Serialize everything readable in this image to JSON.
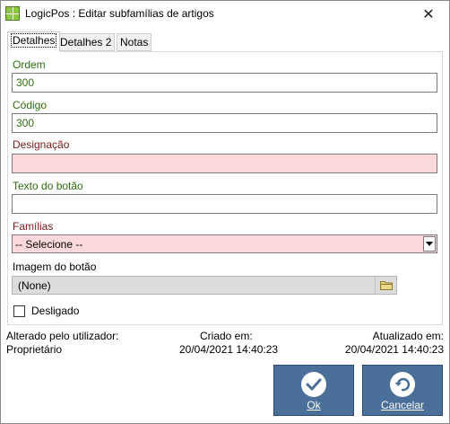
{
  "window": {
    "title": "LogicPos : Editar subfamílias de artigos",
    "close_glyph": "✕"
  },
  "tabs": [
    {
      "label": "Detalhes",
      "active": true
    },
    {
      "label": "Detalhes 2",
      "active": false
    },
    {
      "label": "Notas",
      "active": false
    }
  ],
  "form": {
    "ordem_label": "Ordem",
    "ordem_value": "300",
    "codigo_label": "Código",
    "codigo_value": "300",
    "designacao_label": "Designação",
    "designacao_value": "",
    "texto_label": "Texto do botão",
    "texto_value": "",
    "familias_label": "Famílias",
    "familias_value": "-- Selecione --",
    "imagem_label": "Imagem do botão",
    "imagem_value": "(None)",
    "desligado_label": "Desligado",
    "desligado_checked": false
  },
  "footer": {
    "alterado_label": "Alterado pelo utilizador:",
    "alterado_value": "Proprietário",
    "criado_label": "Criado em:",
    "criado_value": "20/04/2021 14:40:23",
    "atualizado_label": "Atualizado em:",
    "atualizado_value": "20/04/2021 14:40:23"
  },
  "buttons": {
    "ok_label": "Ok",
    "cancel_label": "Cancelar"
  },
  "colors": {
    "required_field_bg": "#fdd8dc",
    "button_bg": "#4a6f98",
    "label_green": "#2e6e0e",
    "label_red": "#7a1a1a"
  },
  "icons": {
    "app": "logicpos-app-icon",
    "close": "close-icon",
    "dropdown": "chevron-down-icon",
    "folder": "folder-icon",
    "ok": "checkmark-icon",
    "cancel": "undo-arrow-icon"
  }
}
